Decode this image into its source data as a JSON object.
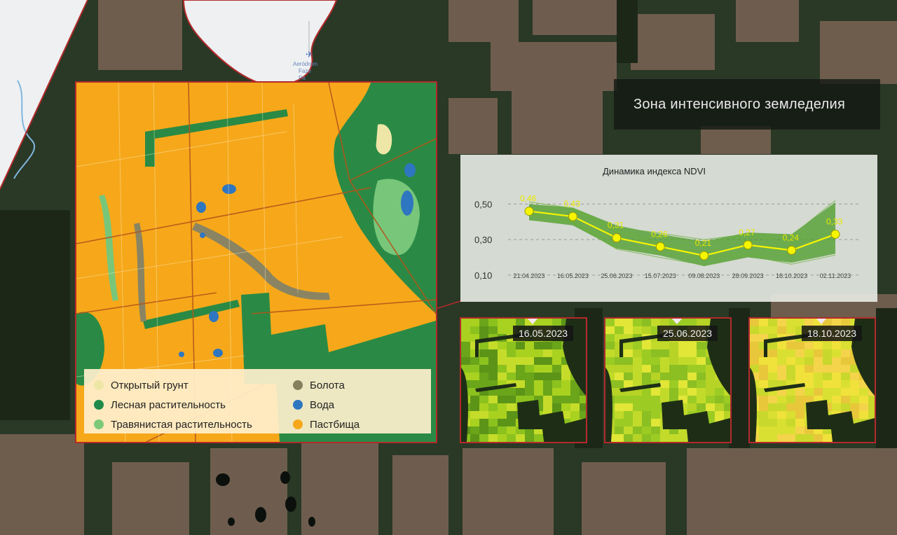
{
  "map_overlay": {
    "airport_label_lines": [
      "Aeródrom",
      "Faze",
      "Pa"
    ],
    "colors": {
      "forest_dark": "#23331f",
      "fields": "#6b5a4c",
      "pasture": "#f6a81a",
      "forest": "#2a8a45",
      "grass": "#78c67a",
      "water": "#2f76c0",
      "swamp": "#8a8462",
      "bare_soil": "#eee6a6",
      "border": "#b32a2a"
    }
  },
  "legend": {
    "items": [
      {
        "label": "Открытый грунт",
        "color": "#eee6a6",
        "icon": "bare-soil"
      },
      {
        "label": "Лесная растительность",
        "color": "#1f8a4a",
        "icon": "forest"
      },
      {
        "label": "Травянистая растительность",
        "color": "#7dc97a",
        "icon": "grass"
      },
      {
        "label": "Болота",
        "color": "#857f5e",
        "icon": "swamp"
      },
      {
        "label": "Вода",
        "color": "#2f76c0",
        "icon": "water"
      },
      {
        "label": "Пастбища",
        "color": "#f6a81a",
        "icon": "pasture"
      }
    ]
  },
  "zone_title": "Зона интенсивного земледелия",
  "chart_data": {
    "type": "line",
    "title": "Динамика индекса NDVI",
    "categories": [
      "21.04.2023",
      "16.05.2023",
      "25.06.2023",
      "15.07.2023",
      "09.08.2023",
      "28.09.2023",
      "18.10.2023",
      "02.11.2023"
    ],
    "series": [
      {
        "values": [
          0.46,
          0.43,
          0.31,
          0.26,
          0.21,
          0.27,
          0.24,
          0.33
        ],
        "color": "#f5f500"
      }
    ],
    "data_labels": [
      "0,46",
      "0,43",
      "0,31",
      "0,26",
      "0,21",
      "0,27",
      "0,24",
      "0,33"
    ],
    "y_ticks": [
      {
        "value": 0.5,
        "label": "0,50"
      },
      {
        "value": 0.3,
        "label": "0,30"
      },
      {
        "value": 0.1,
        "label": "0,10"
      }
    ],
    "ylim": [
      0.06,
      0.62
    ],
    "grid": "dashed horizontal",
    "envelope": {
      "upper": [
        0.5,
        0.48,
        0.38,
        0.33,
        0.29,
        0.34,
        0.33,
        0.51
      ],
      "lower": [
        0.41,
        0.38,
        0.25,
        0.21,
        0.15,
        0.2,
        0.17,
        0.22
      ],
      "color": "#4a9a2a"
    }
  },
  "thumbnails": [
    {
      "date": "16.05.2023"
    },
    {
      "date": "25.06.2023"
    },
    {
      "date": "18.10.2023"
    }
  ]
}
